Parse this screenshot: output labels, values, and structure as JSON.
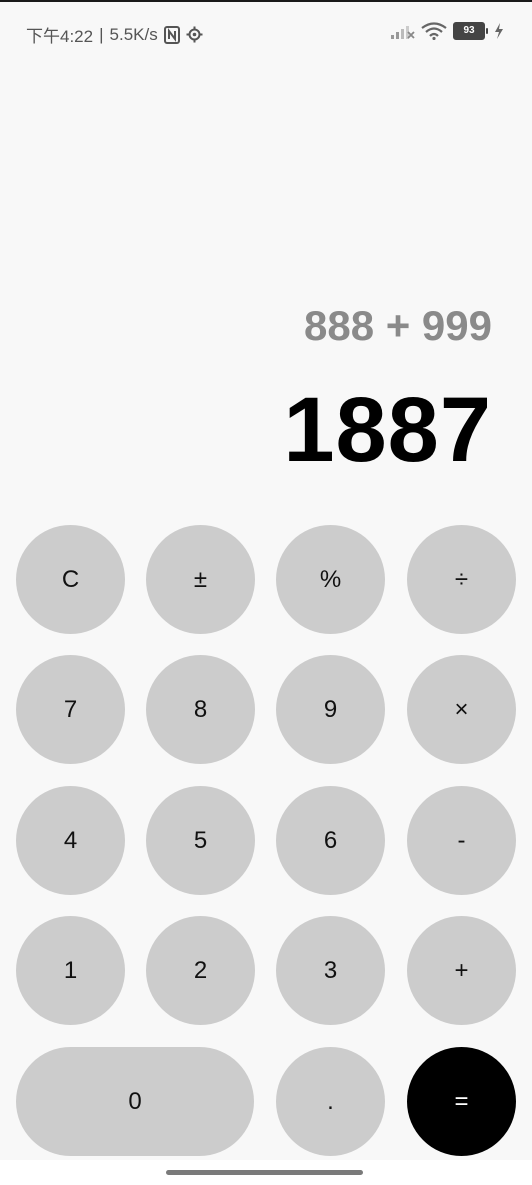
{
  "status_bar": {
    "time": "下午4:22",
    "separator": "|",
    "speed": "5.5K/s",
    "battery_level": "93",
    "icons": [
      "nfc-icon",
      "settings-icon",
      "signal-icon",
      "wifi-icon",
      "battery-icon",
      "charging-icon"
    ]
  },
  "display": {
    "expression": "888 + 999",
    "result": "1887"
  },
  "keypad": {
    "clear": "C",
    "negate": "±",
    "percent": "%",
    "divide": "÷",
    "seven": "7",
    "eight": "8",
    "nine": "9",
    "multiply": "×",
    "four": "4",
    "five": "5",
    "six": "6",
    "subtract": "-",
    "one": "1",
    "two": "2",
    "three": "3",
    "add": "+",
    "zero": "0",
    "decimal": ".",
    "equals": "="
  },
  "colors": {
    "background": "#f8f8f8",
    "key": "#cccccc",
    "equals_key": "#000000",
    "expression_text": "#8a8a8a",
    "result_text": "#000000"
  }
}
